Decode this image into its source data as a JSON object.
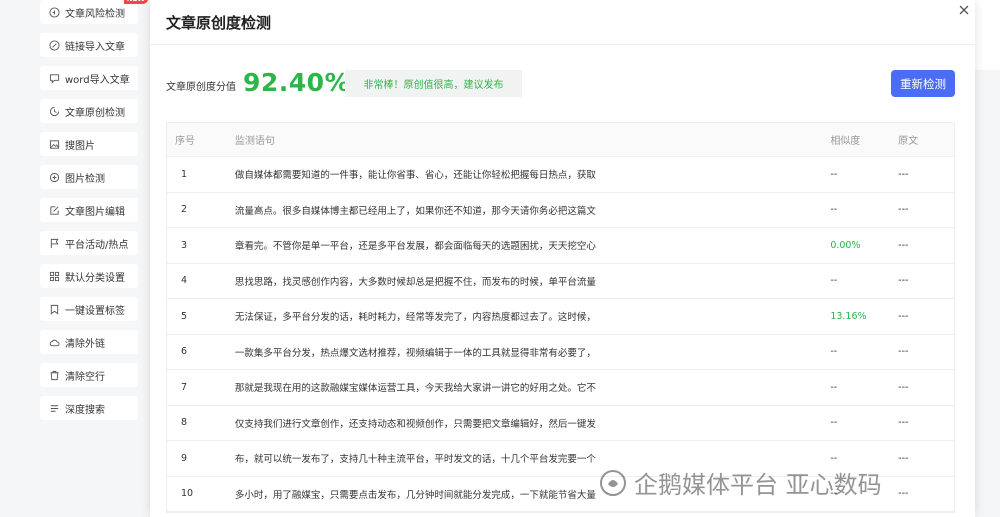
{
  "sidebar": {
    "items": [
      {
        "label": "文章风险检测",
        "icon": "shield-check-icon",
        "badge": "NEW"
      },
      {
        "label": "链接导入文章",
        "icon": "link-icon"
      },
      {
        "label": "word导入文章",
        "icon": "chat-bubble-icon"
      },
      {
        "label": "文章原创检测",
        "icon": "refresh-clock-icon"
      },
      {
        "label": "搜图片",
        "icon": "image-icon"
      },
      {
        "label": "图片检测",
        "icon": "zoom-in-icon"
      },
      {
        "label": "文章图片编辑",
        "icon": "edit-icon"
      },
      {
        "label": "平台活动/热点",
        "icon": "flag-icon"
      },
      {
        "label": "默认分类设置",
        "icon": "grid-icon"
      },
      {
        "label": "一键设置标签",
        "icon": "bookmark-icon"
      },
      {
        "label": "清除外链",
        "icon": "cloud-icon"
      },
      {
        "label": "清除空行",
        "icon": "trash-icon"
      },
      {
        "label": "深度搜索",
        "icon": "list-icon"
      }
    ]
  },
  "modal": {
    "title": "文章原创度检测",
    "score_label": "文章原创度分值",
    "score_value": "92.40%",
    "score_message": "非常棒！原创值很高，建议发布",
    "recheck_label": "重新检测",
    "accent_color": "#2db54a",
    "button_color": "#4b6cf5"
  },
  "table": {
    "headers": {
      "no": "序号",
      "text": "监测语句",
      "similarity": "相似度",
      "source": "原文"
    },
    "rows": [
      {
        "no": "1",
        "text": "做自媒体都需要知道的一件事，能让你省事、省心，还能让你轻松把握每日热点，获取",
        "similarity": "--",
        "source": "---"
      },
      {
        "no": "2",
        "text": "流量高点。很多自媒体博主都已经用上了，如果你还不知道，那今天请你务必把这篇文",
        "similarity": "--",
        "source": "---"
      },
      {
        "no": "3",
        "text": "章看完。不管你是单一平台，还是多平台发展，都会面临每天的选题困扰，天天挖空心",
        "similarity": "0.00%",
        "source": "---"
      },
      {
        "no": "4",
        "text": "思找思路，找灵感创作内容，大多数时候却总是把握不住，而发布的时候，单平台流量",
        "similarity": "--",
        "source": "---"
      },
      {
        "no": "5",
        "text": "无法保证，多平台分发的话，耗时耗力，经常等发完了，内容热度都过去了。这时候，",
        "similarity": "13.16%",
        "source": "---"
      },
      {
        "no": "6",
        "text": "一款集多平台分发，热点爆文选材推荐，视频编辑于一体的工具就显得非常有必要了，",
        "similarity": "--",
        "source": "---"
      },
      {
        "no": "7",
        "text": "那就是我现在用的这款融媒宝媒体运营工具，今天我给大家讲一讲它的好用之处。它不",
        "similarity": "--",
        "source": "---"
      },
      {
        "no": "8",
        "text": "仅支持我们进行文章创作，还支持动态和视频创作，只需要把文章编辑好，然后一键发",
        "similarity": "--",
        "source": "---"
      },
      {
        "no": "9",
        "text": "布，就可以统一发布了，支持几十种主流平台，平时发文的话，十几个平台发完要一个",
        "similarity": "--",
        "source": "---"
      },
      {
        "no": "10",
        "text": "多小时，用了融媒宝，只需要点击发布，几分钟时间就能分发完成，一下就能节省大量",
        "similarity": "--",
        "source": "---"
      }
    ]
  },
  "watermark": {
    "text": "企鹅媒体平台 亚心数码",
    "icon": "penguin-logo-icon"
  }
}
